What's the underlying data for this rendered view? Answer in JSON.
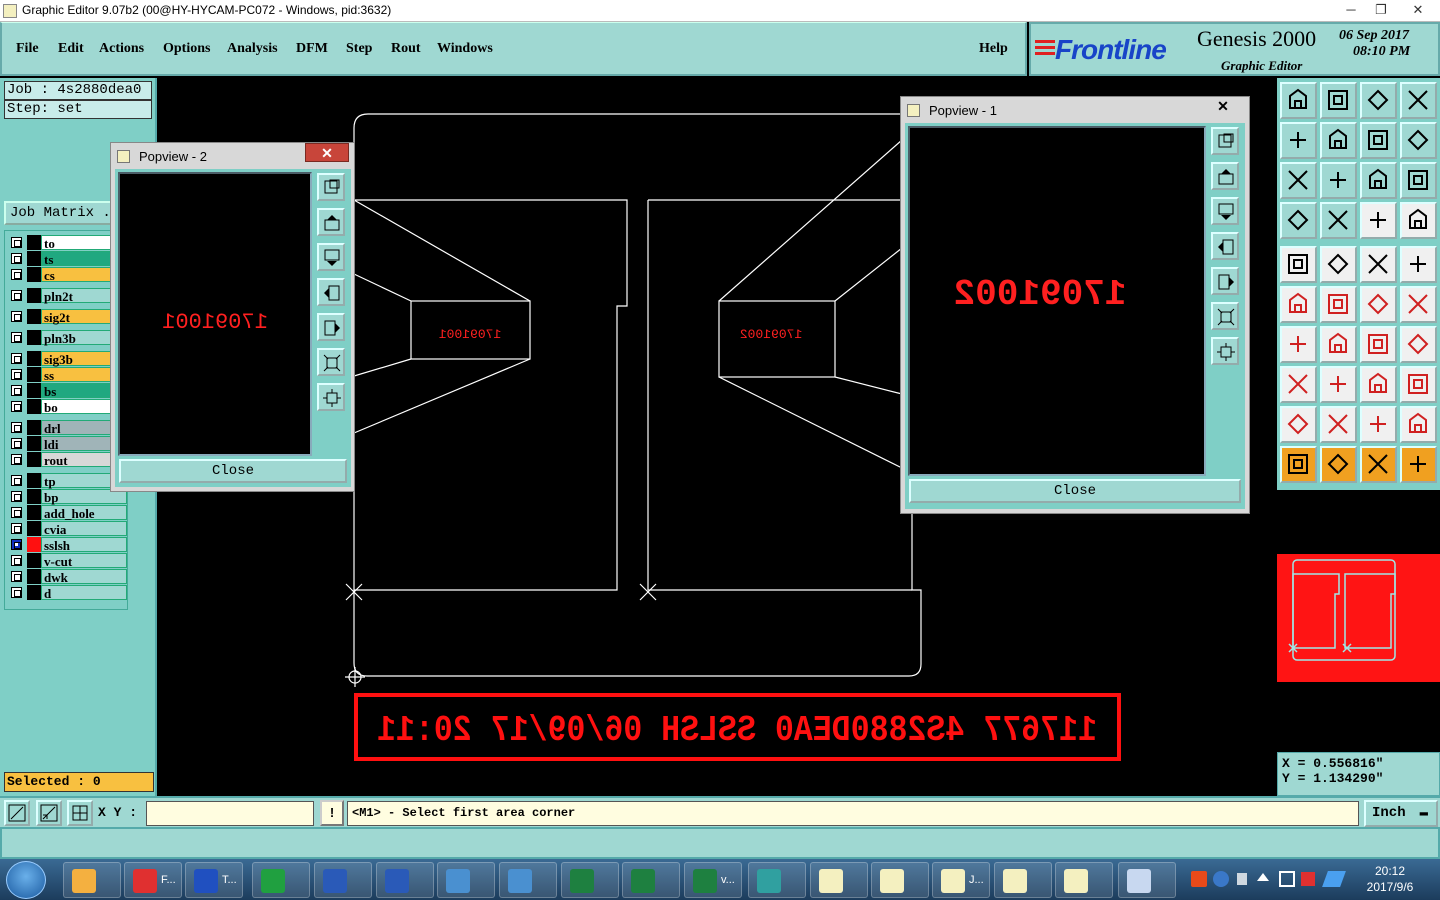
{
  "window": {
    "title": "Graphic Editor 9.07b2 (00@HY-HYCAM-PC072 - Windows, pid:3632)",
    "minimize": "─",
    "restore": "❐",
    "close": "✕"
  },
  "menu": {
    "items": [
      "File",
      "Edit",
      "Actions",
      "Options",
      "Analysis",
      "DFM",
      "Step",
      "Rout",
      "Windows"
    ],
    "help": "Help"
  },
  "brand": {
    "logo": "Frontline",
    "product": "Genesis 2000",
    "subtitle": "Graphic Editor",
    "date": "06  Sep  2017",
    "time": "08:10  PM"
  },
  "job": {
    "job_line": "Job : 4s2880dea0",
    "step_line": "Step: set",
    "matrix_button": "Job Matrix ..."
  },
  "layers": [
    {
      "name": "to",
      "color": "#ffffff"
    },
    {
      "name": "ts",
      "color": "#20a880"
    },
    {
      "name": "cs",
      "color": "#f8c040"
    },
    {
      "name": "pln2t",
      "color": "#9fd8d2"
    },
    {
      "name": "sig2t",
      "color": "#f8c040"
    },
    {
      "name": "pln3b",
      "color": "#9fd8d2"
    },
    {
      "name": "sig3b",
      "color": "#f8c040"
    },
    {
      "name": "ss",
      "color": "#f8c040"
    },
    {
      "name": "bs",
      "color": "#20a880"
    },
    {
      "name": "bo",
      "color": "#ffffff"
    },
    {
      "name": "drl",
      "color": "#a0b4b8"
    },
    {
      "name": "ldi",
      "color": "#a0b4b8"
    },
    {
      "name": "rout",
      "color": "#d8d8d8"
    },
    {
      "name": "tp",
      "color": "#9fd8d2"
    },
    {
      "name": "bp",
      "color": "#9fd8d2"
    },
    {
      "name": "add_hole",
      "color": "#9fd8d2"
    },
    {
      "name": "cvia",
      "color": "#9fd8d2"
    },
    {
      "name": "sslsh",
      "color": "#9fd8d2"
    },
    {
      "name": "v-cut",
      "color": "#9fd8d2"
    },
    {
      "name": "dwk",
      "color": "#9fd8d2"
    },
    {
      "name": "d",
      "color": "#9fd8d2"
    }
  ],
  "selected": "Selected : 0",
  "canvas": {
    "small_text_left": "17091001",
    "small_text_right": "17091002",
    "banner_text": "117677   4S2880DEA0 SSLSH 06/09/17 20:11"
  },
  "popview2": {
    "title": "Popview - 2",
    "close_x": "✕",
    "screen_text": "17091001",
    "close_button": "Close"
  },
  "popview1": {
    "title": "Popview - 1",
    "close_x": "✕",
    "screen_text": "17091002",
    "close_button": "Close"
  },
  "coords": {
    "x": "X = 0.556816\"",
    "y": "Y = 1.134290\""
  },
  "command": {
    "xy_label": "X Y :",
    "xy_value": "",
    "warn": "!",
    "prompt": "<M1> - Select first area corner",
    "unit": "Inch"
  },
  "taskbar": {
    "items": [
      {
        "label": "",
        "icon": "shell-icon"
      },
      {
        "label": "F...",
        "icon": "genesis-icon"
      },
      {
        "label": "T...",
        "icon": "floppy-icon"
      },
      {
        "label": "",
        "icon": "p-icon"
      },
      {
        "label": "",
        "icon": "word-icon"
      },
      {
        "label": "",
        "icon": "word-icon"
      },
      {
        "label": "",
        "icon": "picture-icon"
      },
      {
        "label": "",
        "icon": "picture-icon"
      },
      {
        "label": "",
        "icon": "excel-icon"
      },
      {
        "label": "",
        "icon": "excel-icon"
      },
      {
        "label": "v...",
        "icon": "excel-icon"
      },
      {
        "label": "",
        "icon": "eye-icon"
      },
      {
        "label": "",
        "icon": "x-window-icon"
      },
      {
        "label": "",
        "icon": "x-window-icon"
      },
      {
        "label": "J...",
        "icon": "x-window-icon"
      },
      {
        "label": "",
        "icon": "x-window-icon"
      },
      {
        "label": "",
        "icon": "x-window-icon"
      },
      {
        "label": "",
        "icon": "font-icon"
      }
    ],
    "clock_time": "20:12",
    "clock_date": "2017/9/6"
  }
}
